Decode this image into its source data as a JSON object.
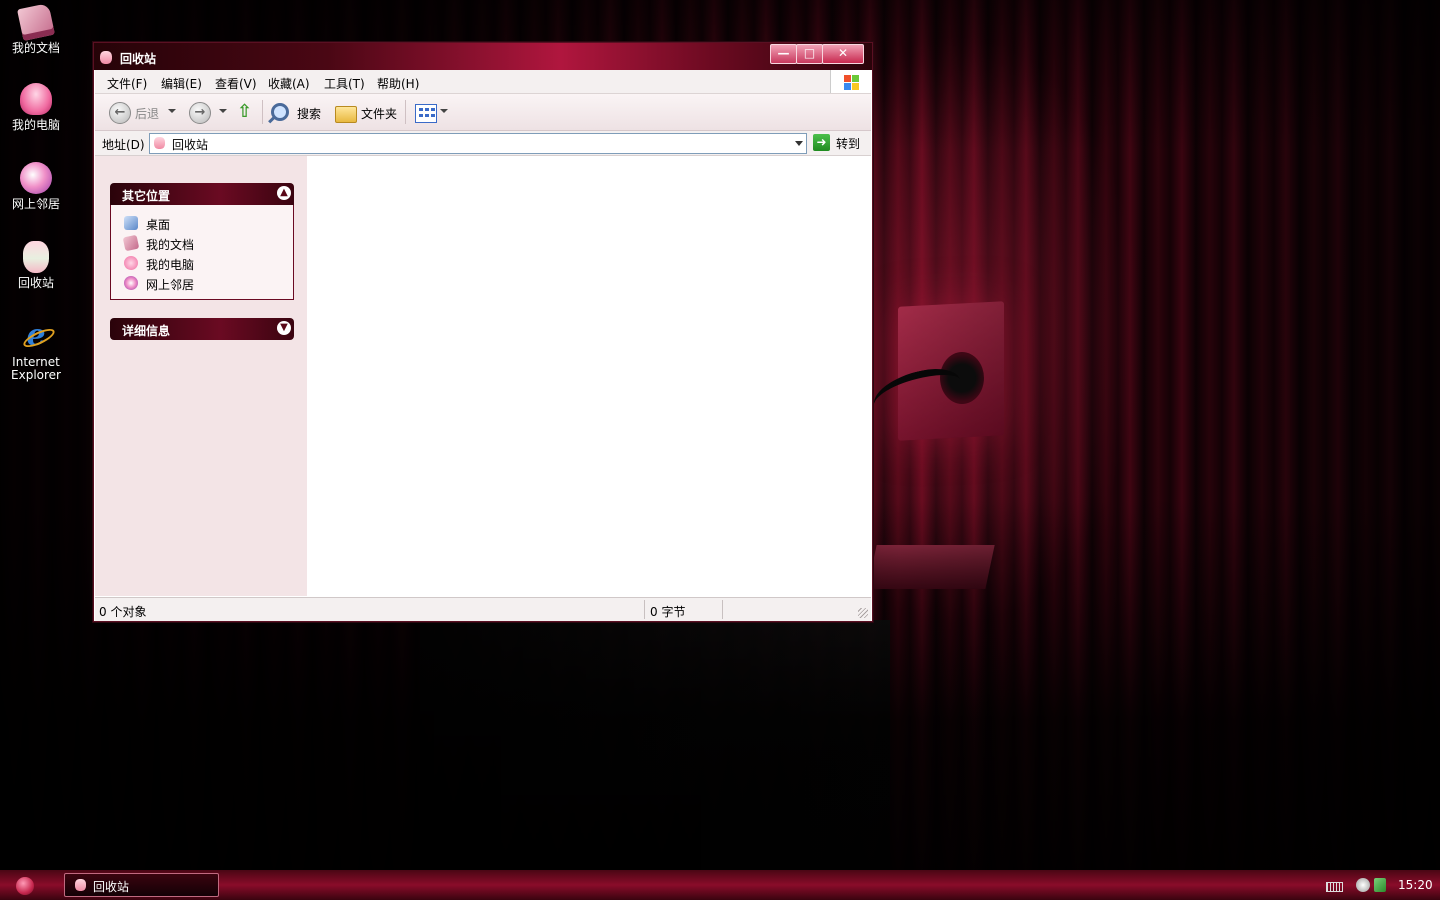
{
  "desktop": {
    "icons": [
      {
        "label": "我的文档",
        "icon": "my-documents-icon"
      },
      {
        "label": "我的电脑",
        "icon": "my-computer-icon"
      },
      {
        "label": "网上邻居",
        "icon": "network-places-icon"
      },
      {
        "label": "回收站",
        "icon": "recycle-bin-icon"
      },
      {
        "label": "Internet Explorer",
        "icon": "internet-explorer-icon"
      }
    ]
  },
  "window": {
    "title": "回收站",
    "menu": [
      "文件(F)",
      "编辑(E)",
      "查看(V)",
      "收藏(A)",
      "工具(T)",
      "帮助(H)"
    ],
    "toolbar": {
      "back": "后退",
      "search": "搜索",
      "folders": "文件夹"
    },
    "address": {
      "label": "地址(D)",
      "value": "回收站",
      "go": "转到"
    },
    "taskpane": {
      "other_places": {
        "title": "其它位置",
        "items": [
          {
            "label": "桌面",
            "icon": "desktop-icon"
          },
          {
            "label": "我的文档",
            "icon": "my-documents-icon"
          },
          {
            "label": "我的电脑",
            "icon": "my-computer-icon"
          },
          {
            "label": "网上邻居",
            "icon": "network-places-icon"
          }
        ]
      },
      "details": {
        "title": "详细信息"
      }
    },
    "status": {
      "objects": "0 个对象",
      "size": "0 字节"
    }
  },
  "taskbar": {
    "tasks": [
      {
        "label": "回收站"
      }
    ],
    "clock": "15:20"
  },
  "colors": {
    "accent": "#8a0c2a",
    "titlebar": "#b0163e",
    "taskpane_bg": "#f3e4e6"
  }
}
